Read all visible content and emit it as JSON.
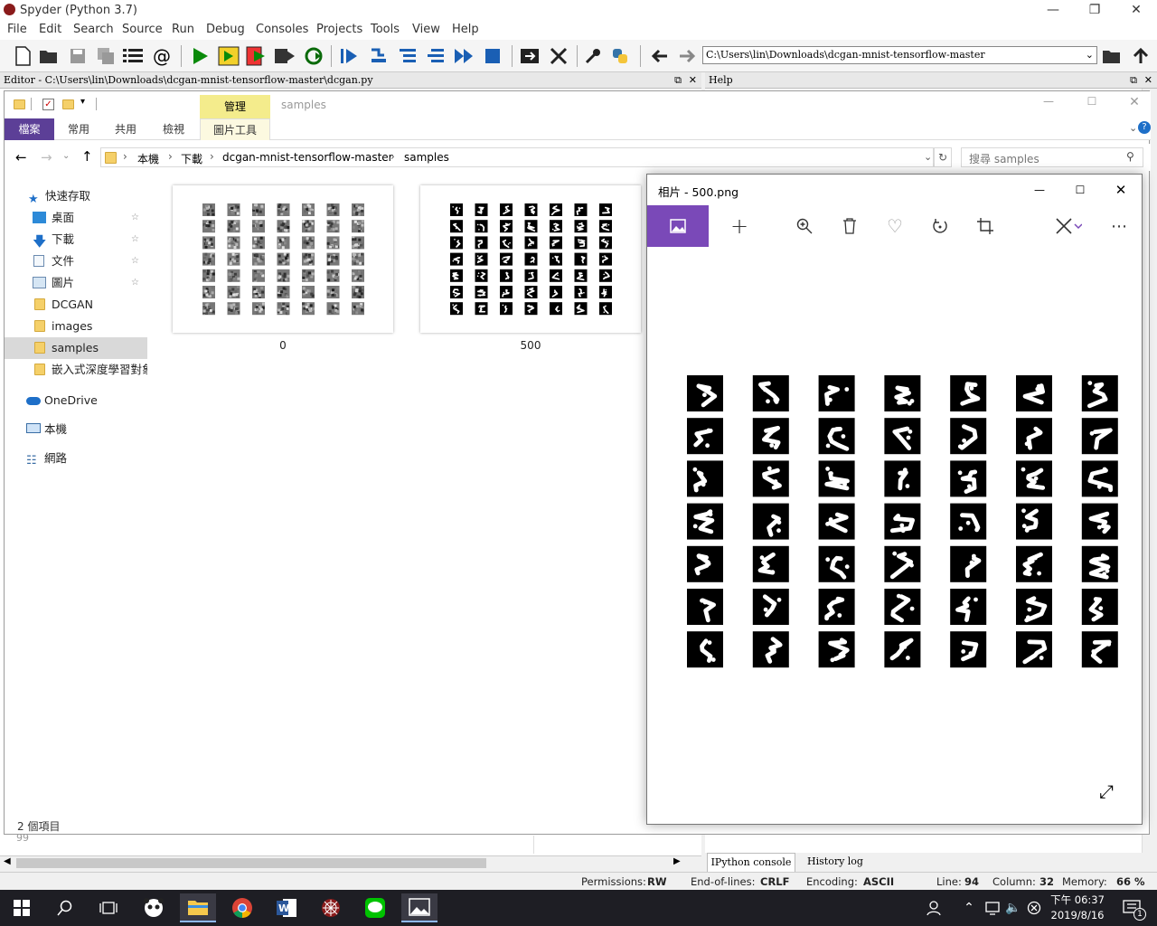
{
  "spyder": {
    "title": "Spyder (Python 3.7)",
    "menu": [
      "File",
      "Edit",
      "Search",
      "Source",
      "Run",
      "Debug",
      "Consoles",
      "Projects",
      "Tools",
      "View",
      "Help"
    ],
    "path": "C:\\Users\\lin\\Downloads\\dcgan-mnist-tensorflow-master",
    "editor_title": "Editor - C:\\Users\\lin\\Downloads\\dcgan-mnist-tensorflow-master\\dcgan.py",
    "help_title": "Help",
    "line_number": "99",
    "console_tabs": [
      "IPython console",
      "History log"
    ],
    "status": {
      "permissions_label": "Permissions:",
      "permissions": "RW",
      "eol_label": "End-of-lines:",
      "eol": "CRLF",
      "encoding_label": "Encoding:",
      "encoding": "ASCII",
      "line_label": "Line:",
      "line": "94",
      "column_label": "Column:",
      "column": "32",
      "memory_label": "Memory:",
      "memory": "66 %"
    }
  },
  "explorer": {
    "title": "samples",
    "ribbon_context": "管理",
    "ribbon_tabs": [
      "檔案",
      "常用",
      "共用",
      "檢視",
      "圖片工具"
    ],
    "breadcrumb": [
      "本機",
      "下載",
      "dcgan-mnist-tensorflow-master",
      "samples"
    ],
    "search_placeholder": "搜尋 samples",
    "nav": {
      "quick_access": "快速存取",
      "desktop": "桌面",
      "downloads": "下載",
      "documents": "文件",
      "pictures": "圖片",
      "dcgan": "DCGAN",
      "images": "images",
      "samples": "samples",
      "embedded": "嵌入式深度學習對象",
      "onedrive": "OneDrive",
      "this_pc": "本機",
      "network": "網路"
    },
    "files": [
      {
        "name": "0"
      },
      {
        "name": "500"
      }
    ],
    "item_count": "2 個項目"
  },
  "photos": {
    "title": "相片 - 500.png",
    "grid_rows": 7,
    "grid_cols": 7
  },
  "taskbar": {
    "time": "下午 06:37",
    "date": "2019/8/16",
    "notification_count": "1",
    "accent": "#0078d7"
  },
  "colors": {
    "photos_accent": "#7a49b8",
    "file_tab": "#5c3f97",
    "ribbon_context": "#f4ec8c"
  }
}
